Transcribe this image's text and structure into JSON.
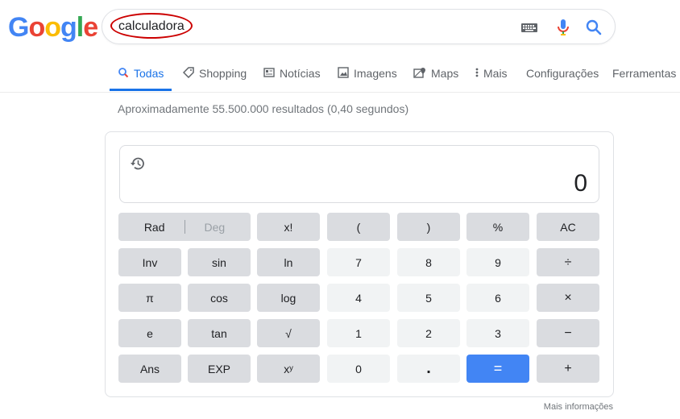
{
  "logo": {
    "letters": [
      "G",
      "o",
      "o",
      "g",
      "l",
      "e"
    ],
    "colors": [
      "#4285f4",
      "#ea4335",
      "#fbbc05",
      "#4285f4",
      "#34a853",
      "#ea4335"
    ]
  },
  "search": {
    "query": "calculadora"
  },
  "tabs": [
    {
      "label": "Todas",
      "icon": "search-icon",
      "active": true
    },
    {
      "label": "Shopping",
      "icon": "tag-icon"
    },
    {
      "label": "Notícias",
      "icon": "news-icon"
    },
    {
      "label": "Imagens",
      "icon": "image-icon"
    },
    {
      "label": "Maps",
      "icon": "map-icon"
    },
    {
      "label": "Mais",
      "icon": "more-vert-icon"
    },
    {
      "label": "Configurações"
    },
    {
      "label": "Ferramentas"
    }
  ],
  "results_stats": "Aproximadamente 55.500.000 resultados (0,40 segundos)",
  "calculator": {
    "display": "0",
    "rad": "Rad",
    "deg": "Deg",
    "keys": {
      "fact": "x!",
      "lparen": "(",
      "rparen": ")",
      "percent": "%",
      "ac": "AC",
      "inv": "Inv",
      "sin": "sin",
      "ln": "ln",
      "n7": "7",
      "n8": "8",
      "n9": "9",
      "divide": "÷",
      "pi": "π",
      "cos": "cos",
      "log": "log",
      "n4": "4",
      "n5": "5",
      "n6": "6",
      "multiply": "×",
      "e": "e",
      "tan": "tan",
      "sqrt": "√",
      "n1": "1",
      "n2": "2",
      "n3": "3",
      "minus": "−",
      "ans": "Ans",
      "exp": "EXP",
      "pow": "xʸ",
      "n0": "0",
      "dot": ".",
      "equals": "=",
      "plus": "+"
    }
  },
  "more_info": "Mais informações"
}
